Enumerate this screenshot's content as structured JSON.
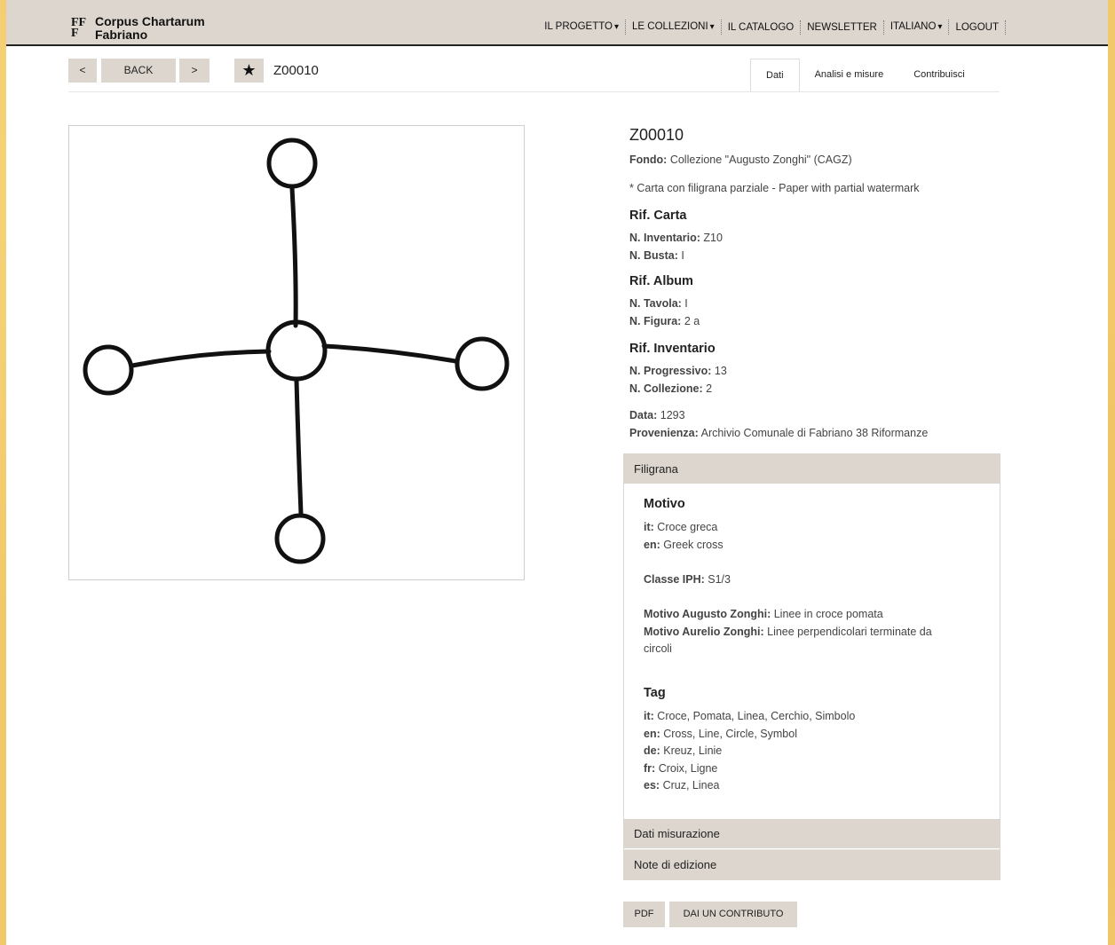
{
  "header": {
    "logo_mark_top": "FF",
    "logo_mark_bottom": "F",
    "logo_line1": "Corpus Chartarum",
    "logo_line2": "Fabriano",
    "nav": {
      "progetto": "IL PROGETTO",
      "collezioni": "LE COLLEZIONI",
      "catalogo": "IL CATALOGO",
      "newsletter": "NEWSLETTER",
      "lingua": "ITALIANO",
      "logout": "LOGOUT",
      "caret": "▾"
    }
  },
  "toolbar": {
    "prev": "<",
    "back": "BACK",
    "next": ">",
    "star": "★",
    "record_id": "Z00010",
    "tabs": {
      "dati": "Dati",
      "analisi": "Analisi e misure",
      "contribuisci": "Contribuisci"
    }
  },
  "record": {
    "title": "Z00010",
    "fondo_label": "Fondo:",
    "fondo_value": "Collezione \"Augusto Zonghi\" (CAGZ)",
    "note": "* Carta con filigrana parziale - Paper with partial watermark",
    "rif_carta": {
      "heading": "Rif. Carta",
      "inventario_label": "N. Inventario:",
      "inventario_value": "Z10",
      "busta_label": "N. Busta:",
      "busta_value": "I"
    },
    "rif_album": {
      "heading": "Rif. Album",
      "tavola_label": "N. Tavola:",
      "tavola_value": "I",
      "figura_label": "N. Figura:",
      "figura_value": "2 a"
    },
    "rif_inventario": {
      "heading": "Rif. Inventario",
      "progressivo_label": "N. Progressivo:",
      "progressivo_value": "13",
      "collezione_label": "N. Collezione:",
      "collezione_value": "2"
    },
    "data_label": "Data:",
    "data_value": "1293",
    "provenienza_label": "Provenienza:",
    "provenienza_value": "Archivio Comunale di Fabriano 38 Riformanze"
  },
  "filigrana": {
    "heading": "Filigrana",
    "motivo_heading": "Motivo",
    "it_label": "it:",
    "it_value": "Croce greca",
    "en_label": "en:",
    "en_value": "Greek cross",
    "classe_label": "Classe IPH:",
    "classe_value": "S1/3",
    "augusto_label": "Motivo Augusto Zonghi:",
    "augusto_value": "Linee in croce pomata",
    "aurelio_label": "Motivo Aurelio Zonghi:",
    "aurelio_value": "Linee perpendicolari terminate da",
    "aurelio_value2": "circoli",
    "tag_heading": "Tag",
    "tags": {
      "it_label": "it:",
      "it_value": "Croce, Pomata, Linea, Cerchio, Simbolo",
      "en_label": "en:",
      "en_value": "Cross, Line, Circle, Symbol",
      "de_label": "de:",
      "de_value": "Kreuz, Linie",
      "fr_label": "fr:",
      "fr_value": "Croix, Ligne",
      "es_label": "es:",
      "es_value": "Cruz, Linea"
    }
  },
  "accordion": {
    "misurazione": "Dati misurazione",
    "note_edizione": "Note di edizione"
  },
  "actions": {
    "pdf": "PDF",
    "contributo": "DAI UN CONTRIBUTO"
  }
}
